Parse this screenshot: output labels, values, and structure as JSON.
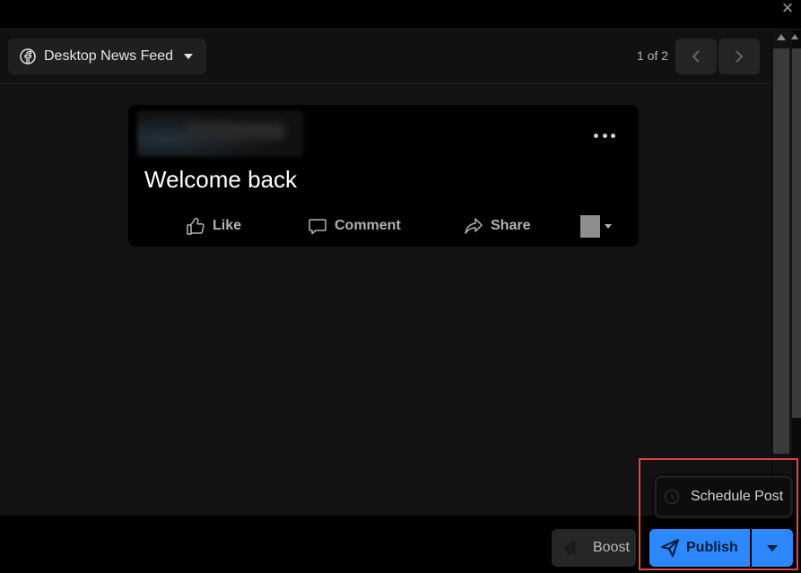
{
  "window": {
    "close_icon": "close-icon"
  },
  "header": {
    "placement_label": "Desktop News Feed",
    "placement_icon": "facebook-icon",
    "pager_text": "1 of 2",
    "prev_icon": "chevron-left-icon",
    "next_icon": "chevron-right-icon"
  },
  "post": {
    "text": "Welcome back",
    "more_icon": "more-options-icon",
    "actions": {
      "like": "Like",
      "comment": "Comment",
      "share": "Share"
    }
  },
  "footer": {
    "boost_label": "Boost",
    "publish_label": "Publish",
    "schedule_label": "Schedule Post"
  },
  "colors": {
    "accent": "#2d88ff",
    "highlight": "#e04646",
    "background": "#121212"
  }
}
